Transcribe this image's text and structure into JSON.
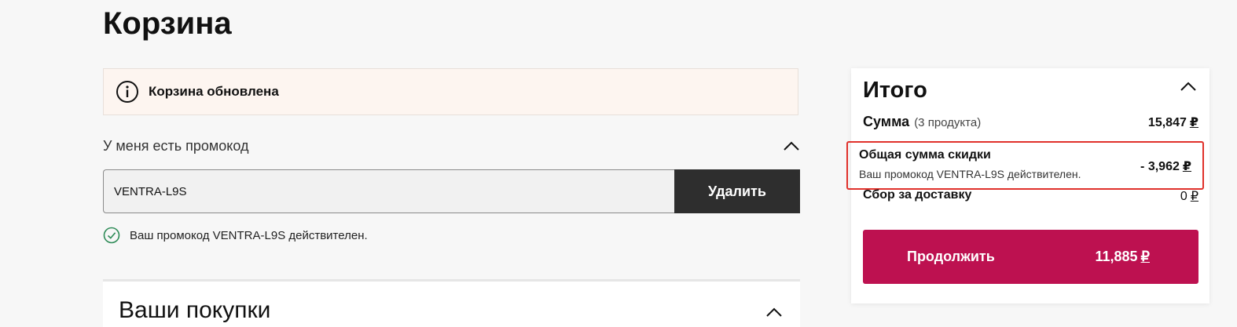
{
  "page": {
    "title": "Корзина"
  },
  "notice": {
    "text": "Корзина обновлена",
    "icon": "info-icon"
  },
  "promo": {
    "toggle_label": "У меня есть промокод",
    "input_value": "VENTRA-L9S",
    "remove_label": "Удалить",
    "valid_message": "Ваш промокод VENTRA-L9S действителен.",
    "valid_icon": "check-circle-icon"
  },
  "purchases": {
    "title": "Ваши покупки"
  },
  "summary": {
    "title": "Итого",
    "sum_label": "Сумма",
    "sum_count": "(3 продукта)",
    "sum_amount": "15,847",
    "currency": "₽",
    "discount_label": "Общая сумма скидки",
    "discount_note": "Ваш промокод VENTRA-L9S действителен.",
    "discount_amount": "- 3,962",
    "delivery_label": "Сбор за доставку",
    "delivery_amount": "0",
    "continue_label": "Продолжить",
    "continue_amount": "11,885"
  },
  "colors": {
    "accent": "#bd1150",
    "dark_button": "#2e2e2e",
    "notice_bg": "#fdf5f0",
    "highlight_border": "#e0312b",
    "success": "#2e8b57"
  }
}
